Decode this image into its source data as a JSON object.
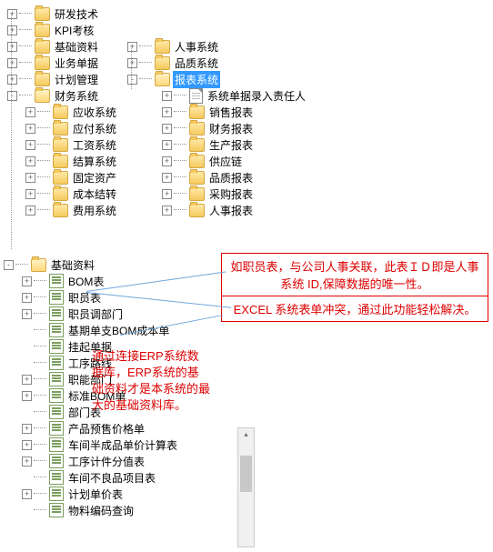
{
  "col1": {
    "items": [
      {
        "label": "研发技术",
        "icon": "folder",
        "toggle": "+"
      },
      {
        "label": "KPI考核",
        "icon": "folder",
        "toggle": "+"
      },
      {
        "label": "基础资料",
        "icon": "folder",
        "toggle": "+"
      },
      {
        "label": "业务单据",
        "icon": "folder",
        "toggle": "+"
      },
      {
        "label": "计划管理",
        "icon": "folder",
        "toggle": "+"
      },
      {
        "label": "财务系统",
        "icon": "folder",
        "toggle": "-",
        "open": true
      }
    ],
    "finance_children": [
      {
        "label": "应收系统",
        "icon": "folder",
        "toggle": "+"
      },
      {
        "label": "应付系统",
        "icon": "folder",
        "toggle": "+"
      },
      {
        "label": "工资系统",
        "icon": "folder",
        "toggle": "+"
      },
      {
        "label": "结算系统",
        "icon": "folder",
        "toggle": "+"
      },
      {
        "label": "固定资产",
        "icon": "folder",
        "toggle": "+"
      },
      {
        "label": "成本结转",
        "icon": "folder",
        "toggle": "+"
      },
      {
        "label": "费用系统",
        "icon": "folder",
        "toggle": "+"
      }
    ]
  },
  "col2": {
    "top": [
      {
        "label": "人事系统",
        "icon": "folder",
        "toggle": "+"
      },
      {
        "label": "品质系统",
        "icon": "folder",
        "toggle": "+"
      },
      {
        "label": "报表系统",
        "icon": "folder",
        "toggle": "-",
        "open": true,
        "selected": true
      }
    ],
    "report_children": [
      {
        "label": "系统单据录入责任人",
        "icon": "doc",
        "toggle": "+"
      },
      {
        "label": "销售报表",
        "icon": "folder",
        "toggle": "+"
      },
      {
        "label": "财务报表",
        "icon": "folder",
        "toggle": "+"
      },
      {
        "label": "生产报表",
        "icon": "folder",
        "toggle": "+"
      },
      {
        "label": "供应链",
        "icon": "folder",
        "toggle": "+"
      },
      {
        "label": "品质报表",
        "icon": "folder",
        "toggle": "+"
      },
      {
        "label": "采购报表",
        "icon": "folder",
        "toggle": "+"
      },
      {
        "label": "人事报表",
        "icon": "folder",
        "toggle": "+"
      }
    ]
  },
  "bottom": {
    "root": {
      "label": "基础资料",
      "icon": "folder",
      "toggle": "-"
    },
    "items": [
      {
        "label": "BOM表",
        "icon": "sheet",
        "toggle": "+"
      },
      {
        "label": "职员表",
        "icon": "sheet",
        "toggle": "+"
      },
      {
        "label": "职员调部门",
        "icon": "sheet",
        "toggle": "+"
      },
      {
        "label": "基期单支BOM成本单",
        "icon": "sheet",
        "toggle": ""
      },
      {
        "label": "挂起单据",
        "icon": "sheet",
        "toggle": ""
      },
      {
        "label": "工序路线",
        "icon": "sheet",
        "toggle": ""
      },
      {
        "label": "职能部门",
        "icon": "sheet",
        "toggle": "+"
      },
      {
        "label": "标准BOM单",
        "icon": "sheet",
        "toggle": "+"
      },
      {
        "label": "部门表",
        "icon": "sheet",
        "toggle": ""
      },
      {
        "label": "产品预售价格单",
        "icon": "sheet",
        "toggle": "+"
      },
      {
        "label": "车间半成品单价计算表",
        "icon": "sheet",
        "toggle": "+"
      },
      {
        "label": "工序计件分值表",
        "icon": "sheet",
        "toggle": "+"
      },
      {
        "label": "车间不良品项目表",
        "icon": "sheet",
        "toggle": ""
      },
      {
        "label": "计划单价表",
        "icon": "sheet",
        "toggle": "+"
      },
      {
        "label": "物料编码查询",
        "icon": "sheet",
        "toggle": ""
      }
    ]
  },
  "callouts": {
    "c1": "如职员表，与公司人事关联，此表ＩＤ即是人事系统 ID,保障数据的唯一性。",
    "c2": "EXCEL 系统表单冲突，通过此功能轻松解决。",
    "c3": "通过连接ERP系统数据库，ERP系统的基础资料才是本系统的最大的基础资料库。"
  }
}
